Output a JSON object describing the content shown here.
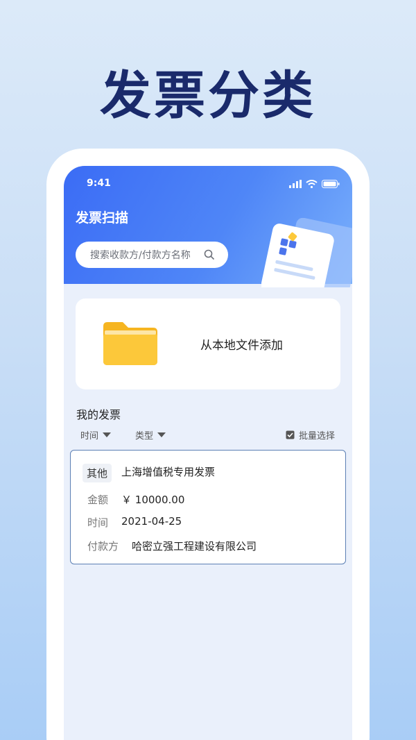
{
  "promo": {
    "title": "发票分类"
  },
  "status_bar": {
    "time": "9:41"
  },
  "header": {
    "title": "发票扫描"
  },
  "search": {
    "placeholder": "搜索收款方/付款方名称"
  },
  "add_local": {
    "label": "从本地文件添加"
  },
  "invoices_section": {
    "title": "我的发票",
    "filters": [
      {
        "label": "时间"
      },
      {
        "label": "类型"
      }
    ],
    "batch_select": "批量选择"
  },
  "invoice": {
    "tag": "其他",
    "title": "上海增值税专用发票",
    "amount_label": "金额",
    "amount_value": "￥ 10000.00",
    "time_label": "时间",
    "time_value": "2021-04-25",
    "payer_label": "付款方",
    "payer_value": "哈密立强工程建设有限公司"
  },
  "colors": {
    "header_blue": "#3b6cf5",
    "folder_yellow": "#fcc83a",
    "promo_title": "#1a2a6b",
    "card_border": "#5b7fb4"
  },
  "icons": [
    "signal-icon",
    "wifi-icon",
    "battery-icon",
    "search-icon",
    "folder-icon",
    "checkbox-icon",
    "chevron-down-icon"
  ]
}
